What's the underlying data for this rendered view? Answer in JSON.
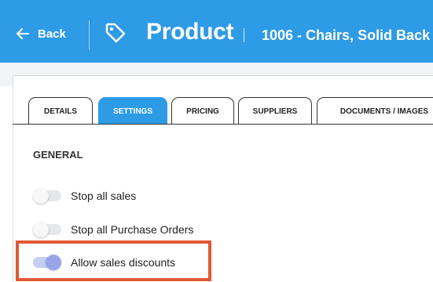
{
  "header": {
    "back_label": "Back",
    "title": "Product",
    "subtitle": "1006 - Chairs, Solid Back"
  },
  "tabs": [
    {
      "label": "DETAILS",
      "active": false
    },
    {
      "label": "SETTINGS",
      "active": true
    },
    {
      "label": "PRICING",
      "active": false
    },
    {
      "label": "SUPPLIERS",
      "active": false
    },
    {
      "label": "DOCUMENTS / IMAGES",
      "active": false
    }
  ],
  "settings": {
    "section_title": "GENERAL",
    "toggles": [
      {
        "label": "Stop all sales",
        "enabled": false
      },
      {
        "label": "Stop all Purchase Orders",
        "enabled": false
      },
      {
        "label": "Allow sales discounts",
        "enabled": true
      }
    ]
  },
  "colors": {
    "header_blue": "#2e9be6",
    "highlight": "#e05a33",
    "toggle_on": "#97a5e8"
  }
}
